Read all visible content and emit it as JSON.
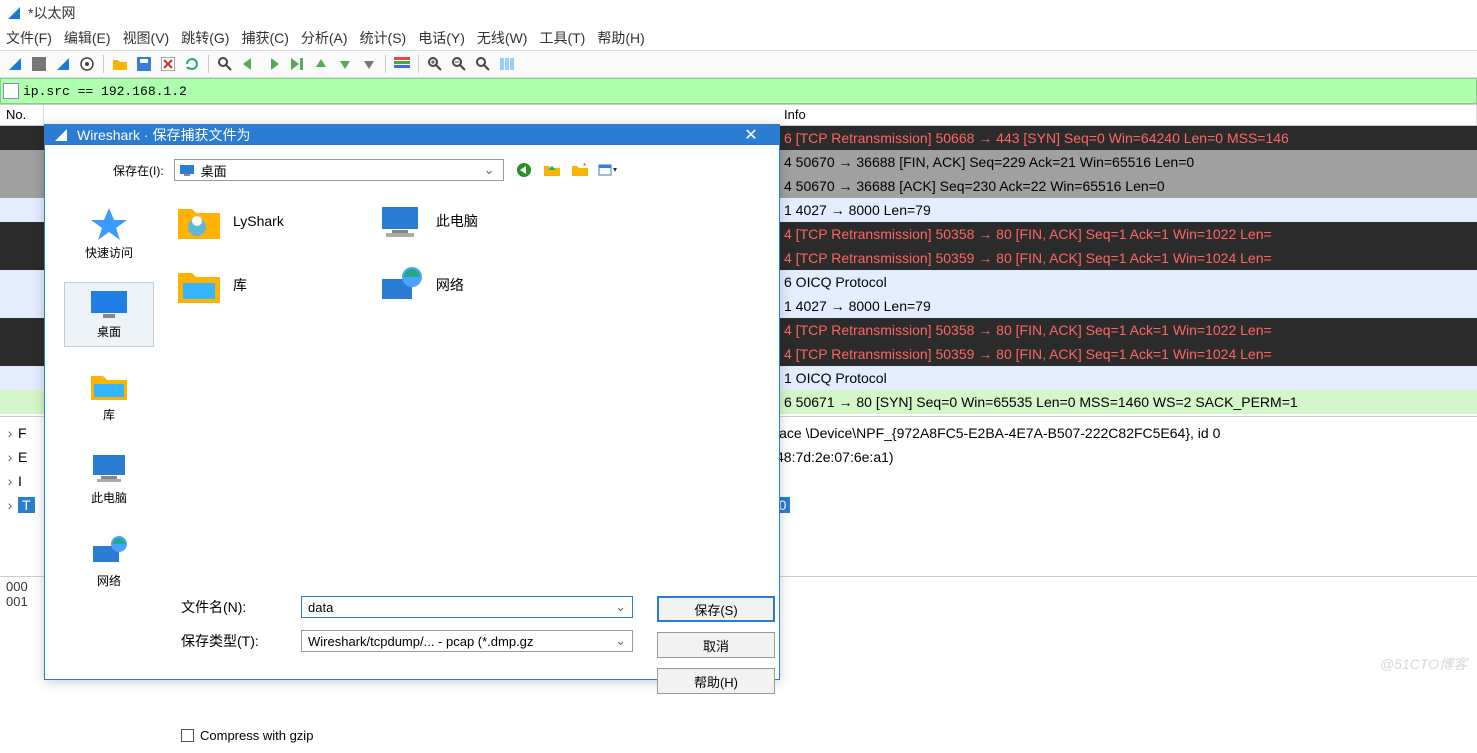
{
  "window": {
    "title": "*以太网"
  },
  "menu": [
    "文件(F)",
    "编辑(E)",
    "视图(V)",
    "跳转(G)",
    "捕获(C)",
    "分析(A)",
    "统计(S)",
    "电话(Y)",
    "无线(W)",
    "工具(T)",
    "帮助(H)"
  ],
  "filter": {
    "value": "ip.src == 192.168.1.2"
  },
  "columns": {
    "no": "No.",
    "info_partial": "  Info"
  },
  "packets": [
    {
      "cls": "r-black",
      "txt": "6 [TCP Retransmission] 50668 → 443 [SYN] Seq=0 Win=64240 Len=0 MSS=146"
    },
    {
      "cls": "r-grey",
      "txt": "4 50670 → 36688 [FIN, ACK] Seq=229 Ack=21 Win=65516 Len=0"
    },
    {
      "cls": "r-grey",
      "txt": "4 50670 → 36688 [ACK] Seq=230 Ack=22 Win=65516 Len=0"
    },
    {
      "cls": "r-lblue",
      "txt": "1 4027 → 8000 Len=79"
    },
    {
      "cls": "r-black",
      "txt": "4 [TCP Retransmission] 50358 → 80 [FIN, ACK] Seq=1 Ack=1 Win=1022 Len="
    },
    {
      "cls": "r-black",
      "txt": "4 [TCP Retransmission] 50359 → 80 [FIN, ACK] Seq=1 Ack=1 Win=1024 Len="
    },
    {
      "cls": "r-lblue",
      "txt": "6 OICQ Protocol"
    },
    {
      "cls": "r-lblue",
      "txt": "1 4027 → 8000 Len=79"
    },
    {
      "cls": "r-black",
      "txt": "4 [TCP Retransmission] 50358 → 80 [FIN, ACK] Seq=1 Ack=1 Win=1022 Len="
    },
    {
      "cls": "r-black",
      "txt": "4 [TCP Retransmission] 50359 → 80 [FIN, ACK] Seq=1 Ack=1 Win=1024 Len="
    },
    {
      "cls": "r-lblue",
      "txt": "1 OICQ Protocol"
    },
    {
      "cls": "r-green",
      "txt": "6 50671 → 80 [SYN] Seq=0 Win=65535 Len=0 MSS=1460 WS=2 SACK_PERM=1"
    }
  ],
  "details": {
    "f": "F",
    "e": "E",
    "i": "I",
    "t": "T",
    "frame_tail": "rface \\Device\\NPF_{972A8FC5-E2BA-4E7A-B507-222C82FC5E64}, id 0",
    "eth_tail": " (48:7d:2e:07:6e:a1)",
    "tcp_tail": "0"
  },
  "hex": {
    "l1": "000",
    "l2": "001"
  },
  "dialog": {
    "title": "Wireshark · 保存捕获文件为",
    "save_in_label": "保存在(I):",
    "save_in_value": "桌面",
    "places": [
      "快速访问",
      "桌面",
      "库",
      "此电脑",
      "网络"
    ],
    "files": {
      "col1": [
        "LyShark",
        "库"
      ],
      "col2": [
        "此电脑",
        "网络"
      ]
    },
    "filename_label": "文件名(N):",
    "filename_value": "data",
    "filetype_label": "保存类型(T):",
    "filetype_value": "Wireshark/tcpdump/... - pcap (*.dmp.gz",
    "btn_save": "保存(S)",
    "btn_cancel": "取消",
    "btn_help": "帮助(H)",
    "gzip_label": "Compress with gzip"
  },
  "watermark": "@51CTO博客"
}
